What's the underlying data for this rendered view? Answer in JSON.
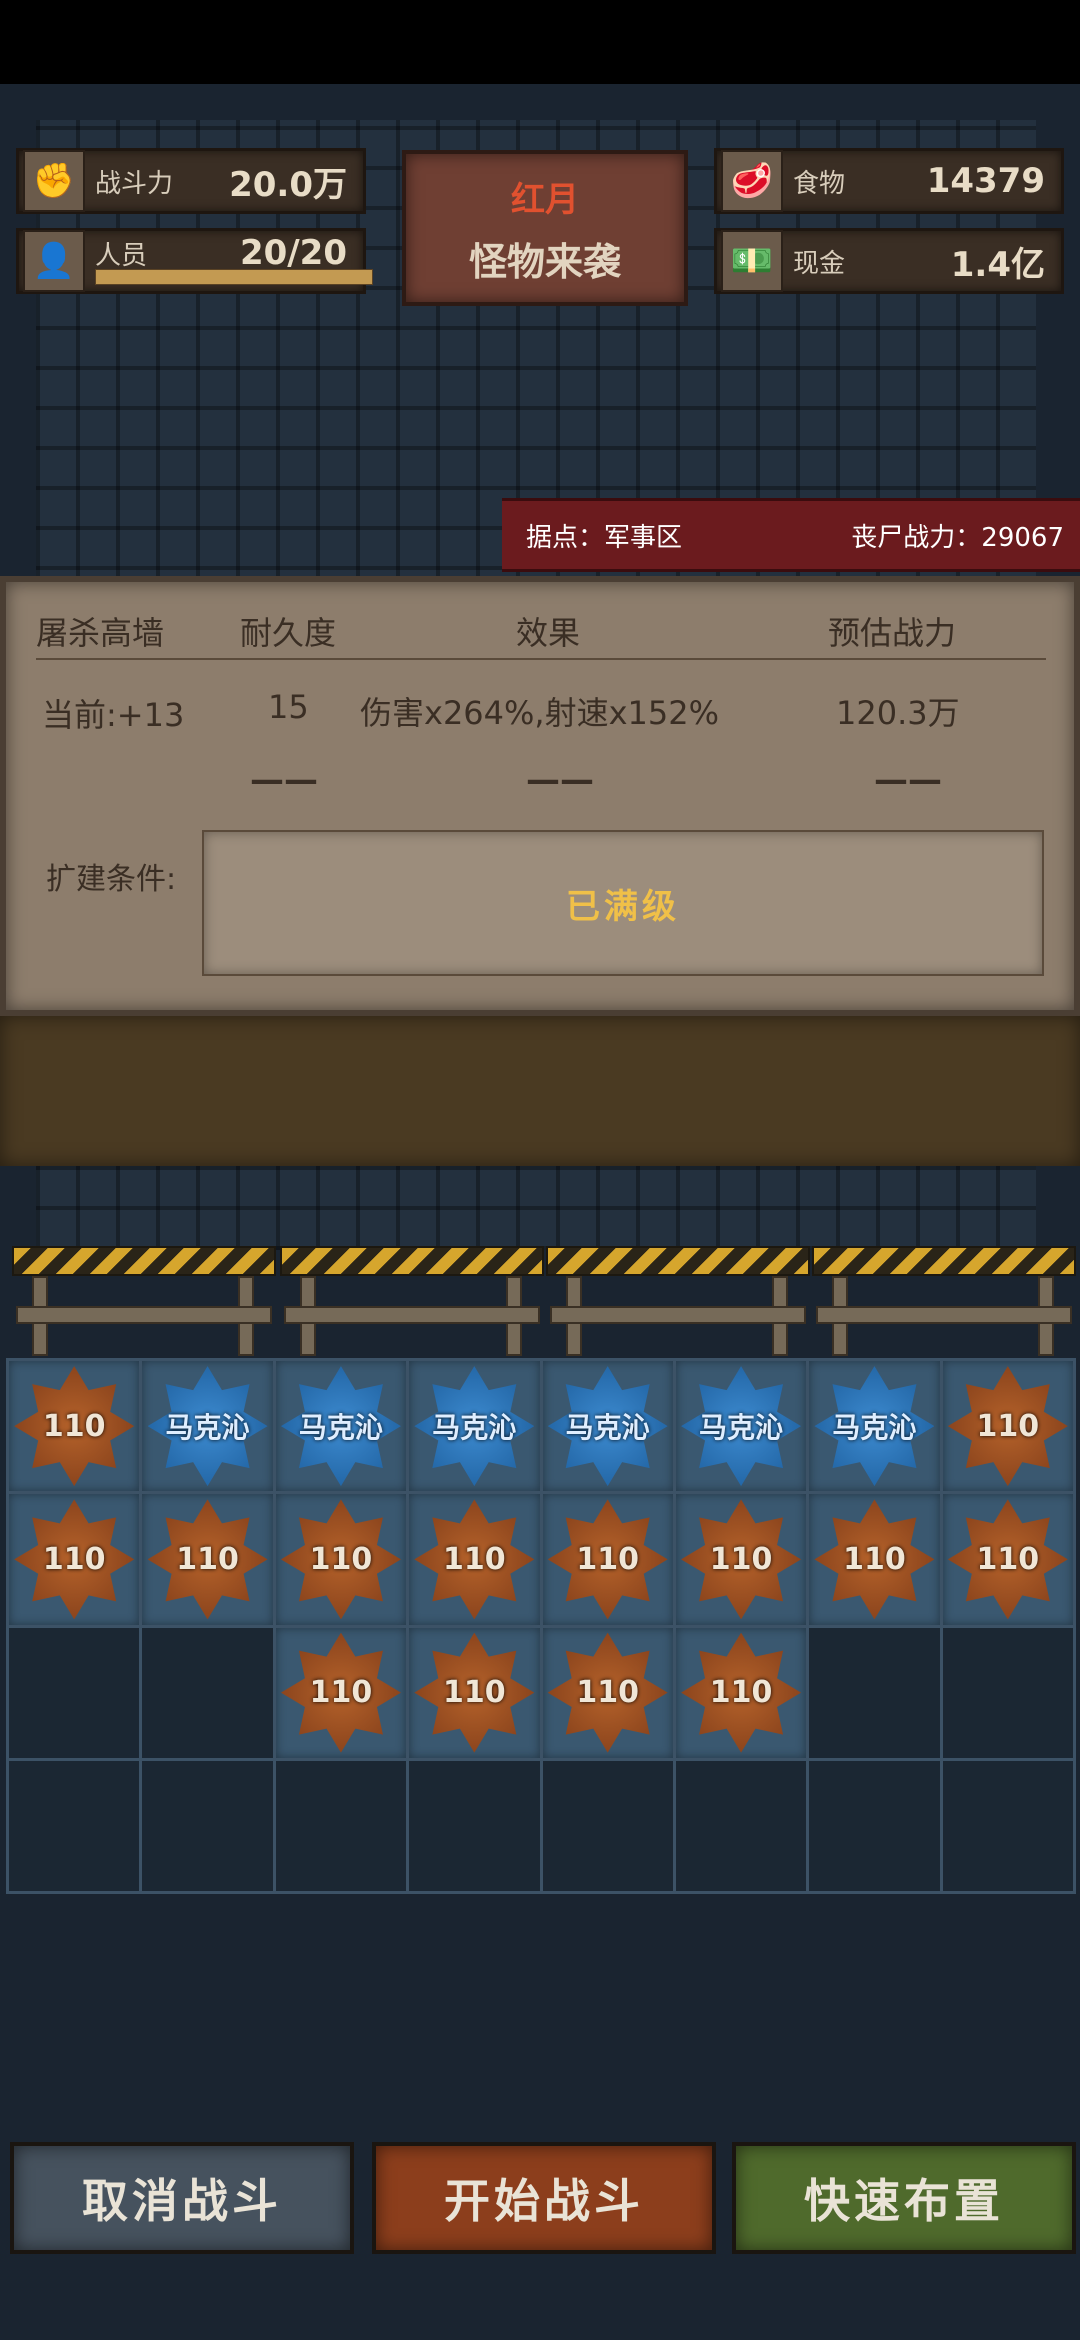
{
  "hud": {
    "combat_power": {
      "label": "战斗力",
      "value": "20.0万",
      "icon": "fist-icon"
    },
    "personnel": {
      "label": "人员",
      "value": "20/20",
      "icon": "person-icon",
      "fill_fraction": 1.0
    },
    "food": {
      "label": "食物",
      "value": "14379",
      "icon": "meat-icon"
    },
    "cash": {
      "label": "现金",
      "value": "1.4亿",
      "icon": "cash-icon"
    }
  },
  "event": {
    "title": "红月",
    "subtitle": "怪物来袭"
  },
  "region": {
    "location": "据点：军事区",
    "zombie_power": "丧尸战力：29067"
  },
  "wall_info": {
    "headers": {
      "name": "屠杀高墙",
      "durability": "耐久度",
      "effect": "效果",
      "estimated_power": "预估战力"
    },
    "current": {
      "level": "当前:+13",
      "durability": "15",
      "effect": "伤害x264%,射速x152%",
      "estimated_power": "120.3万"
    },
    "next": {
      "durability": "——",
      "effect": "——",
      "estimated_power": "——"
    },
    "upgrade_label": "扩建条件:",
    "upgrade_status": "已满级"
  },
  "units": {
    "rows": [
      [
        {
          "type": "orange",
          "label": "110"
        },
        {
          "type": "blue",
          "label": "马克沁"
        },
        {
          "type": "blue",
          "label": "马克沁"
        },
        {
          "type": "blue",
          "label": "马克沁"
        },
        {
          "type": "blue",
          "label": "马克沁"
        },
        {
          "type": "blue",
          "label": "马克沁"
        },
        {
          "type": "blue",
          "label": "马克沁"
        },
        {
          "type": "orange",
          "label": "110"
        }
      ],
      [
        {
          "type": "orange",
          "label": "110"
        },
        {
          "type": "orange",
          "label": "110"
        },
        {
          "type": "orange",
          "label": "110"
        },
        {
          "type": "orange",
          "label": "110"
        },
        {
          "type": "orange",
          "label": "110"
        },
        {
          "type": "orange",
          "label": "110"
        },
        {
          "type": "orange",
          "label": "110"
        },
        {
          "type": "orange",
          "label": "110"
        }
      ],
      [
        null,
        null,
        {
          "type": "orange",
          "label": "110"
        },
        {
          "type": "orange",
          "label": "110"
        },
        {
          "type": "orange",
          "label": "110"
        },
        {
          "type": "orange",
          "label": "110"
        },
        null,
        null
      ],
      [
        null,
        null,
        null,
        null,
        null,
        null,
        null,
        null
      ]
    ]
  },
  "buttons": {
    "cancel": "取消战斗",
    "start": "开始战斗",
    "quick": "快速布置"
  }
}
